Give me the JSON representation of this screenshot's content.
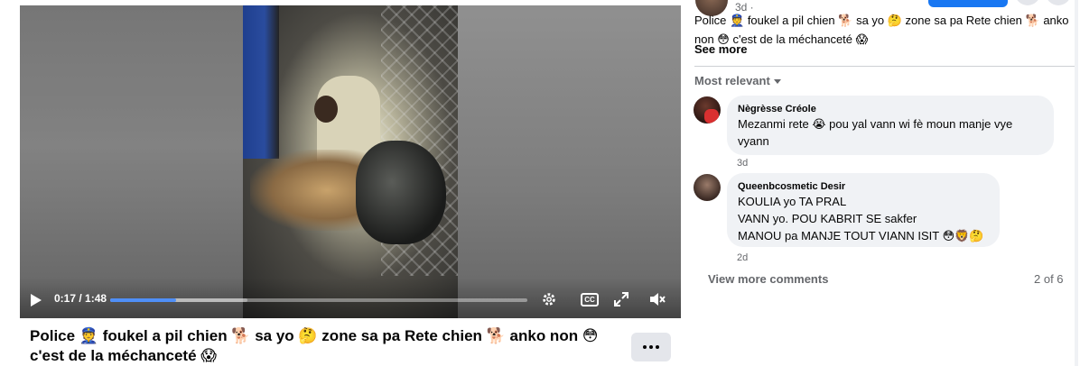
{
  "video": {
    "time_display": "0:17 / 1:48",
    "progress": 0.1574,
    "buffered": 0.33,
    "icons": [
      "play-icon",
      "settings-icon",
      "cc-icon",
      "fullscreen-icon",
      "volume-muted-icon"
    ]
  },
  "post": {
    "title": "Police 👮 foukel a pil chien 🐕 sa yo 🤔 zone sa pa Rete chien 🐕 anko non 😳 c'est de la méchanceté 😱",
    "more_icon": "more-horizontal-icon"
  },
  "panel": {
    "timestamp": "3d ·",
    "description": "Police 👮 foukel a pil chien 🐕 sa yo 🤔 zone sa pa Rete chien 🐕 anko non 😳 c'est de la méchanceté 😱",
    "see_more": "See more",
    "sort_label": "Most relevant"
  },
  "comments": [
    {
      "name": "Nègrèsse Créole",
      "text": "Mezanmi rete 😭 pou yal vann wi fè moun manje vye vyann",
      "time": "3d"
    },
    {
      "name": "Queenbcosmetic Desir",
      "lines": [
        "KOULIA yo TA PRAL",
        "VANN yo. POU KABRIT SE sakfer",
        "MANOU pa MANJE TOUT VIANN ISIT 😳🦁🤔"
      ],
      "time": "2d"
    }
  ],
  "footer": {
    "view_more": "View more comments",
    "pager": "2 of 6"
  },
  "colors": {
    "accent": "#1877f2",
    "bubble": "#f0f2f5",
    "secondary_text": "#65676b"
  }
}
